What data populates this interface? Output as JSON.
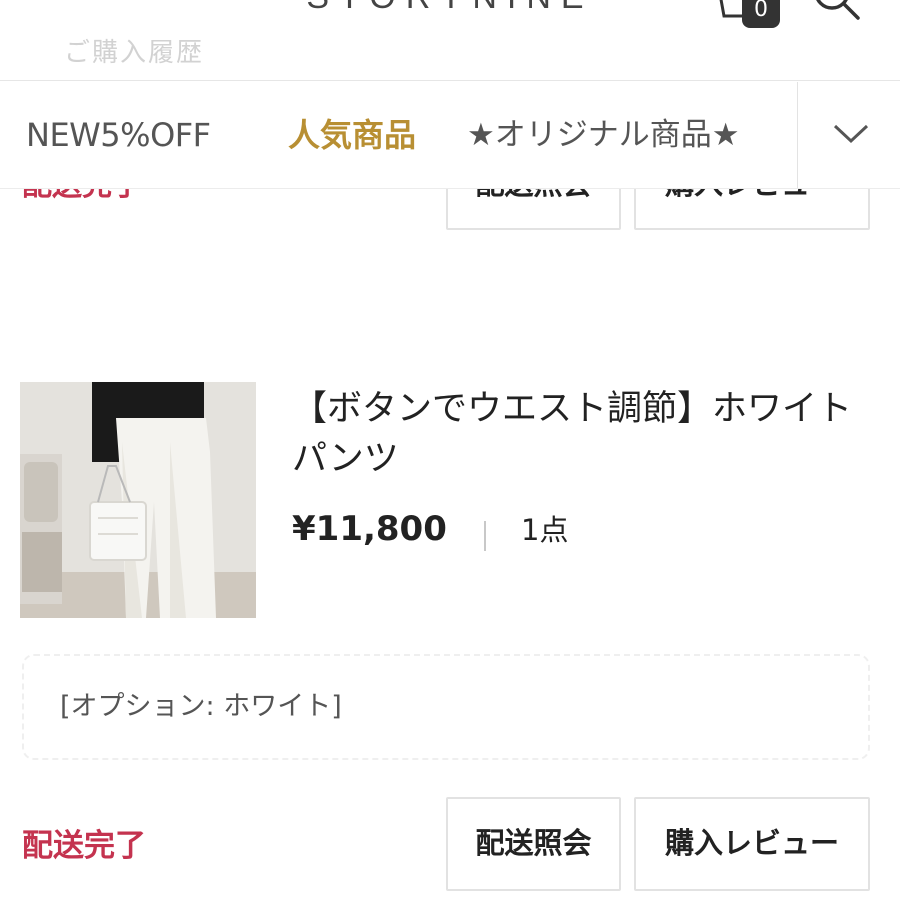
{
  "header": {
    "brand": "STORYNINE",
    "subtitle_faded": "ご購入履歴",
    "cart_count": "0"
  },
  "tabs": [
    {
      "label": "NEW5%OFF"
    },
    {
      "label": "人気商品"
    },
    {
      "label": "★オリジナル商品★"
    }
  ],
  "colors": {
    "accent_gold": "#b88f33",
    "status_red": "#c4334f"
  },
  "previous_order": {
    "status": "配送完了",
    "track_button": "配送照会",
    "review_button": "購入レビュー"
  },
  "order": {
    "product_name": "【ボタンでウエスト調節】ホワイトパンツ",
    "price": "¥11,800",
    "quantity": "1点",
    "option": "[オプション: ホワイト]",
    "status": "配送完了",
    "track_button": "配送照会",
    "review_button": "購入レビュー"
  },
  "icons": [
    "menu-icon",
    "cart-icon",
    "search-icon",
    "chevron-down-icon"
  ]
}
